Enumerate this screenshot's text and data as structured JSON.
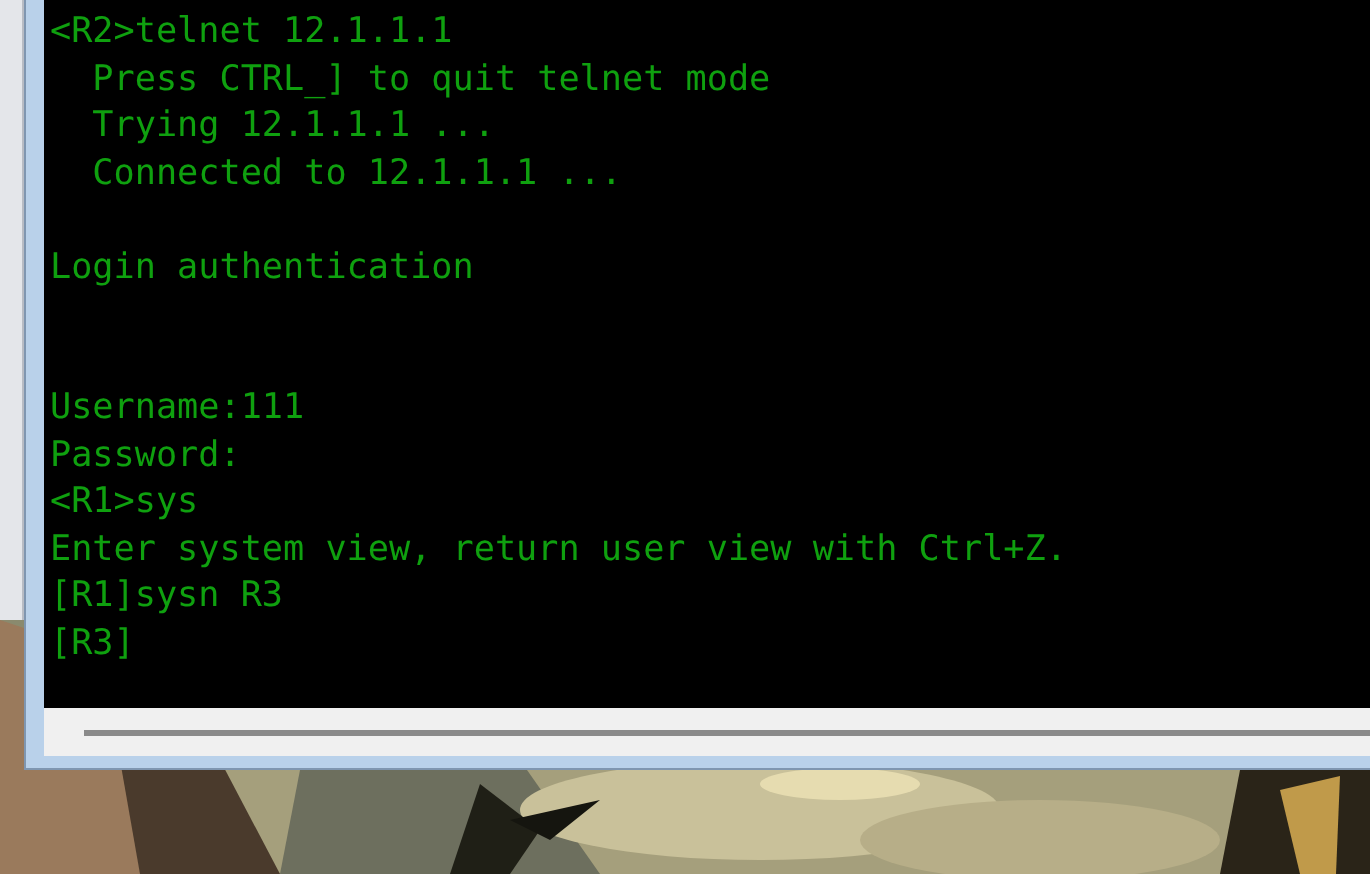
{
  "terminal": {
    "lines": [
      {
        "kind": "text",
        "text": "<R2>telnet 12.1.1.1"
      },
      {
        "kind": "text",
        "text": "  Press CTRL_] to quit telnet mode"
      },
      {
        "kind": "text",
        "text": "  Trying 12.1.1.1 ..."
      },
      {
        "kind": "text",
        "text": "  Connected to 12.1.1.1 ..."
      },
      {
        "kind": "blank"
      },
      {
        "kind": "text",
        "text": "Login authentication"
      },
      {
        "kind": "blank"
      },
      {
        "kind": "blank"
      },
      {
        "kind": "text",
        "text": "Username:111"
      },
      {
        "kind": "text",
        "text": "Password:"
      },
      {
        "kind": "text",
        "text": "<R1>sys"
      },
      {
        "kind": "text",
        "text": "Enter system view, return user view with Ctrl+Z."
      },
      {
        "kind": "text",
        "text": "[R1]sysn R3"
      },
      {
        "kind": "text",
        "text": "[R3]"
      }
    ]
  }
}
